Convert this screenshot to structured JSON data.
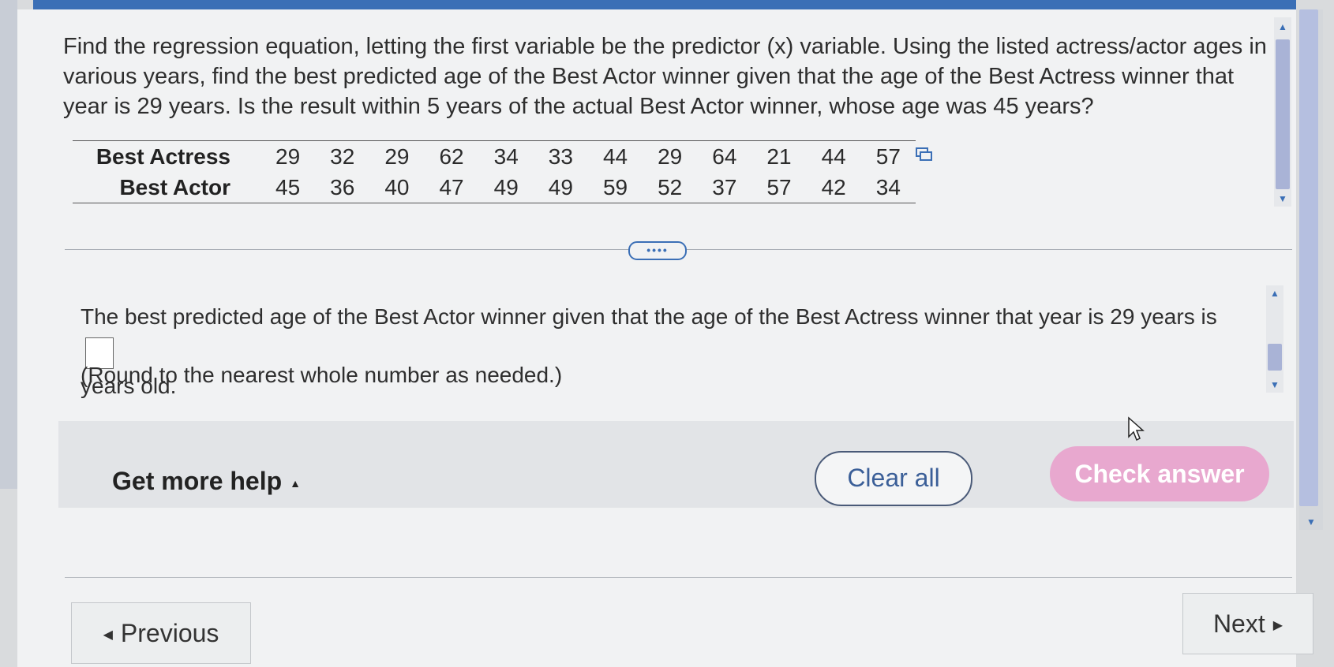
{
  "question": {
    "text": "Find the regression equation, letting the first variable be the predictor (x) variable. Using the listed actress/actor ages in various years, find the best predicted age of the Best Actor winner given that the age of the Best Actress winner that year is 29 years. Is the result within 5 years of the actual Best Actor winner, whose age was 45 years?"
  },
  "table": {
    "rows": [
      {
        "label": "Best Actress",
        "values": [
          "29",
          "32",
          "29",
          "62",
          "34",
          "33",
          "44",
          "29",
          "64",
          "21",
          "44",
          "57"
        ]
      },
      {
        "label": "Best Actor",
        "values": [
          "45",
          "36",
          "40",
          "47",
          "49",
          "49",
          "59",
          "52",
          "37",
          "57",
          "42",
          "34"
        ]
      }
    ]
  },
  "expander_label": "••••",
  "answer": {
    "prefix": "The best predicted age of the Best Actor winner given that the age of the Best Actress winner that year is 29 years is",
    "value": "",
    "suffix": "years old.",
    "hint": "(Round to the nearest whole number as needed.)"
  },
  "footer": {
    "more_help": "Get more help",
    "clear_all": "Clear all",
    "check_answer": "Check answer"
  },
  "nav": {
    "previous": "Previous",
    "next": "Next"
  },
  "colors": {
    "accent": "#3b6fb6",
    "check_button": "#e8a8cf",
    "panel_bg": "#f1f2f3"
  }
}
